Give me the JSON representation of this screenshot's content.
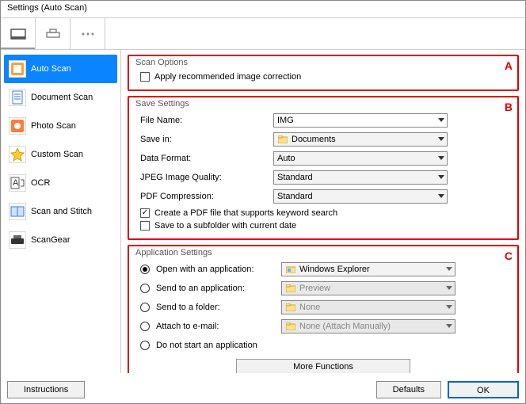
{
  "window": {
    "title": "Settings (Auto Scan)"
  },
  "toolbar": {
    "tabs": [
      "scanner-tab-icon",
      "output-tab-icon",
      "more-tab-icon"
    ]
  },
  "sidebar": {
    "items": [
      {
        "label": "Auto Scan",
        "icon": "auto-scan-icon",
        "selected": true
      },
      {
        "label": "Document Scan",
        "icon": "document-scan-icon",
        "selected": false
      },
      {
        "label": "Photo Scan",
        "icon": "photo-scan-icon",
        "selected": false
      },
      {
        "label": "Custom Scan",
        "icon": "custom-scan-icon",
        "selected": false
      },
      {
        "label": "OCR",
        "icon": "ocr-icon",
        "selected": false
      },
      {
        "label": "Scan and Stitch",
        "icon": "stitch-icon",
        "selected": false
      },
      {
        "label": "ScanGear",
        "icon": "scangear-icon",
        "selected": false
      }
    ]
  },
  "groupA": {
    "legend": "Scan Options",
    "letter": "A",
    "opt1_label": "Apply recommended image correction",
    "opt1_checked": false
  },
  "groupB": {
    "legend": "Save Settings",
    "letter": "B",
    "rows": {
      "file_name": {
        "label": "File Name:",
        "value": "IMG"
      },
      "save_in": {
        "label": "Save in:",
        "value": "Documents"
      },
      "data_format": {
        "label": "Data Format:",
        "value": "Auto"
      },
      "jpeg_q": {
        "label": "JPEG Image Quality:",
        "value": "Standard"
      },
      "pdf_c": {
        "label": "PDF Compression:",
        "value": "Standard"
      }
    },
    "chk_pdf_search": {
      "label": "Create a PDF file that supports keyword search",
      "checked": true
    },
    "chk_subfolder": {
      "label": "Save to a subfolder with current date",
      "checked": false
    }
  },
  "groupC": {
    "legend": "Application Settings",
    "letter": "C",
    "options": [
      {
        "label": "Open with an application:",
        "value": "Windows Explorer",
        "selected": true,
        "has_dd": true,
        "enabled": true
      },
      {
        "label": "Send to an application:",
        "value": "Preview",
        "selected": false,
        "has_dd": true,
        "enabled": false
      },
      {
        "label": "Send to a folder:",
        "value": "None",
        "selected": false,
        "has_dd": true,
        "enabled": false
      },
      {
        "label": "Attach to e-mail:",
        "value": "None (Attach Manually)",
        "selected": false,
        "has_dd": true,
        "enabled": false
      },
      {
        "label": "Do not start an application",
        "value": "",
        "selected": false,
        "has_dd": false,
        "enabled": false
      }
    ],
    "more_functions": "More Functions"
  },
  "footer": {
    "instructions": "Instructions",
    "defaults": "Defaults",
    "ok": "OK"
  }
}
